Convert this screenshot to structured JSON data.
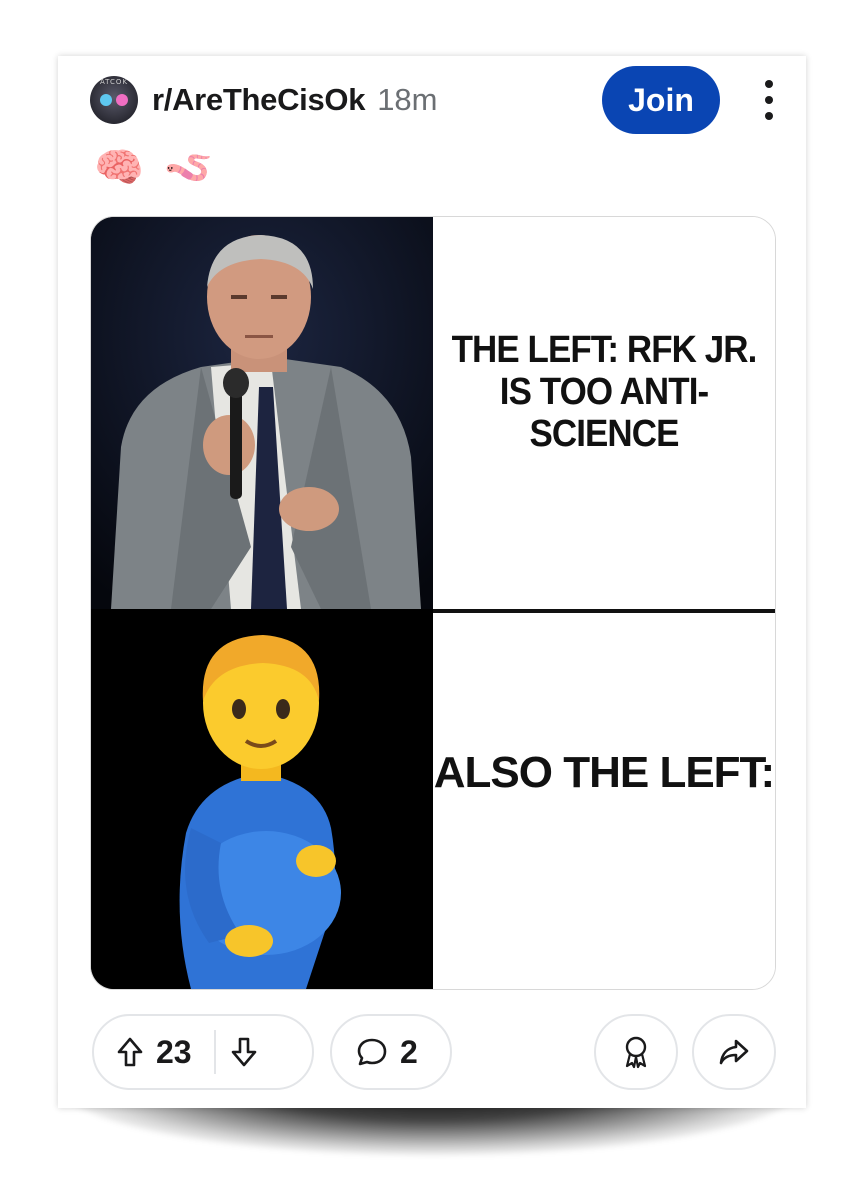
{
  "post": {
    "subreddit": "r/AreTheCisOk",
    "time": "18m",
    "avatar_text": "ATCOK",
    "join_label": "Join",
    "flair": [
      "🧠",
      "🪱"
    ]
  },
  "meme": {
    "top_caption": "THE LEFT: RFK JR. IS TOO ANTI-SCIENCE",
    "bottom_caption": "ALSO THE LEFT:"
  },
  "actions": {
    "upvotes": "23",
    "comments": "2"
  },
  "colors": {
    "accent": "#0a45b3",
    "text": "#1a1a1b",
    "muted": "#6b6f73",
    "border": "#e3e5e8"
  },
  "icons": {
    "more": "more-vertical-icon",
    "upvote": "upvote-arrow-icon",
    "downvote": "downvote-arrow-icon",
    "comment": "comment-bubble-icon",
    "award": "award-icon",
    "share": "share-arrow-icon"
  }
}
